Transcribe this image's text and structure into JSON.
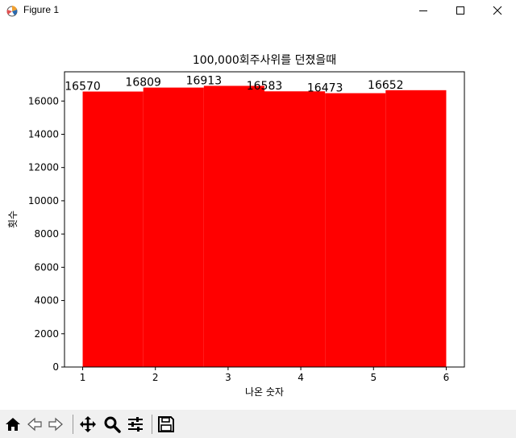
{
  "window": {
    "title": "Figure 1",
    "icons": {
      "app": "matplotlib-figure-icon",
      "minimize": "minimize-icon",
      "maximize": "maximize-icon",
      "close": "close-icon"
    }
  },
  "toolbar": {
    "buttons": [
      {
        "name": "home-icon"
      },
      {
        "name": "back-arrow-icon"
      },
      {
        "name": "forward-arrow-icon"
      },
      {
        "name": "pan-move-icon"
      },
      {
        "name": "zoom-magnifier-icon"
      },
      {
        "name": "configure-subplots-icon"
      },
      {
        "name": "save-disk-icon"
      }
    ]
  },
  "colors": {
    "bar": "#ff0000",
    "background": "#ffffff",
    "toolbar": "#f0f0f0"
  },
  "chart_data": {
    "type": "bar",
    "title": "100,000회주사위를 던졌을때",
    "xlabel": "나온 숫자",
    "ylabel": "횟수",
    "categories": [
      "1",
      "2",
      "3",
      "4",
      "5",
      "6"
    ],
    "values": [
      16570,
      16809,
      16913,
      16583,
      16473,
      16652
    ],
    "data_labels": [
      "16570",
      "16809",
      "16913",
      "16583",
      "16473",
      "16652"
    ],
    "bin_edges": [
      1,
      1.8333,
      2.6667,
      3.5,
      4.3333,
      5.1667,
      6
    ],
    "xlim": [
      0.75,
      6.25
    ],
    "ylim": [
      0,
      17759
    ],
    "xticks": [
      1,
      2,
      3,
      4,
      5,
      6
    ],
    "xtick_labels": [
      "1",
      "2",
      "3",
      "4",
      "5",
      "6"
    ],
    "yticks": [
      0,
      2000,
      4000,
      6000,
      8000,
      10000,
      12000,
      14000,
      16000
    ],
    "ytick_labels": [
      "0",
      "2000",
      "4000",
      "6000",
      "8000",
      "10000",
      "12000",
      "14000",
      "16000"
    ],
    "grid": false,
    "legend": "none"
  }
}
